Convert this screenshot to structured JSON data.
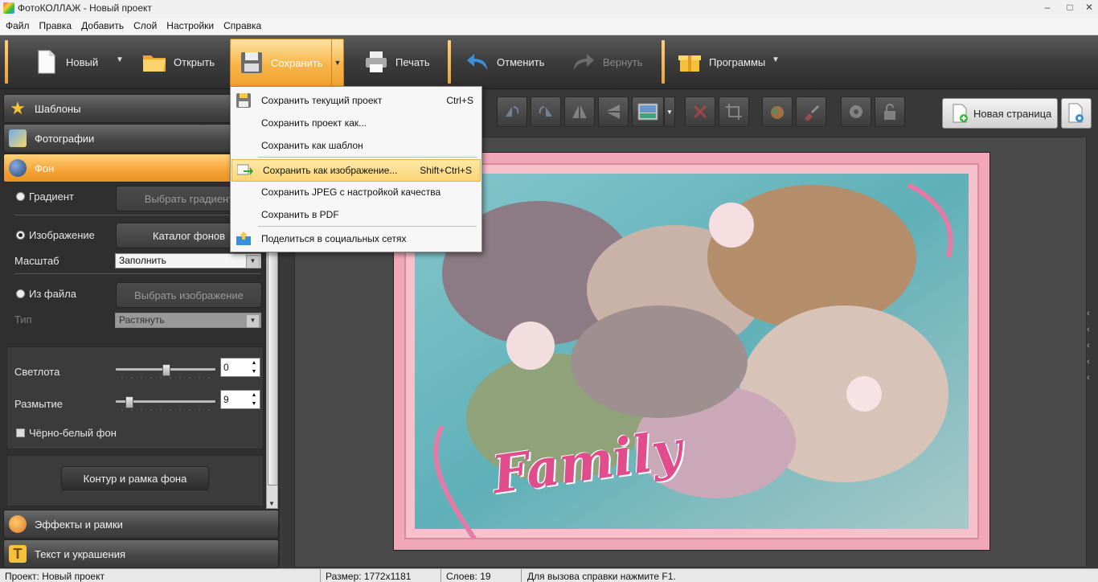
{
  "window": {
    "title": "ФотоКОЛЛАЖ - Новый проект",
    "minimize": "–",
    "maximize": "□",
    "close": "✕"
  },
  "menubar": [
    "Файл",
    "Правка",
    "Добавить",
    "Слой",
    "Настройки",
    "Справка"
  ],
  "toolbar": {
    "new_label": "Новый",
    "open_label": "Открыть",
    "save_label": "Сохранить",
    "print_label": "Печать",
    "undo_label": "Отменить",
    "redo_label": "Вернуть",
    "programs_label": "Программы"
  },
  "save_menu": {
    "items": [
      {
        "label": "Сохранить текущий проект",
        "shortcut": "Ctrl+S",
        "icon": "floppy-icon"
      },
      {
        "label": "Сохранить проект как...",
        "shortcut": "",
        "icon": ""
      },
      {
        "label": "Сохранить как шаблон",
        "shortcut": "",
        "icon": ""
      },
      {
        "label": "Сохранить как изображение...",
        "shortcut": "Shift+Ctrl+S",
        "icon": "export-image-icon",
        "highlighted": true
      },
      {
        "label": "Сохранить JPEG с настройкой качества",
        "shortcut": "",
        "icon": ""
      },
      {
        "label": "Сохранить в PDF",
        "shortcut": "",
        "icon": ""
      },
      {
        "label": "Поделиться в социальных сетях",
        "shortcut": "",
        "icon": "share-icon"
      }
    ]
  },
  "left_panel": {
    "sections": {
      "templates": "Шаблоны",
      "photos": "Фотографии",
      "background": "Фон",
      "effects": "Эффекты и рамки",
      "text": "Текст и украшения"
    },
    "gradient_label": "Градиент",
    "choose_gradient": "Выбрать градиент",
    "image_label": "Изображение",
    "bg_catalog": "Каталог фонов",
    "scale_label": "Масштаб",
    "scale_value": "Заполнить",
    "from_file_label": "Из файла",
    "choose_image": "Выбрать изображение",
    "type_label": "Тип",
    "type_value": "Растянуть",
    "brightness_label": "Светлота",
    "brightness_value": "0",
    "brightness_level": 0.5,
    "blur_label": "Размытие",
    "blur_value": "9",
    "blur_level": 0.1,
    "bw_label": "Чёрно-белый фон",
    "contour_button": "Контур и рамка фона"
  },
  "canvas": {
    "new_page_label": "Новая страница",
    "collage_text": "Family"
  },
  "status": {
    "project": "Проект:  Новый проект",
    "size": "Размер:  1772x1181",
    "layers": "Слоев:  19",
    "help": "Для вызова справки нажмите F1."
  },
  "colors": {
    "accent": "#f5a337",
    "menu_highlight": "#fbd477",
    "collage_frame": "#f0a8b8",
    "collage_bg": "#7fbfc4",
    "family_text": "#e04c8c"
  }
}
